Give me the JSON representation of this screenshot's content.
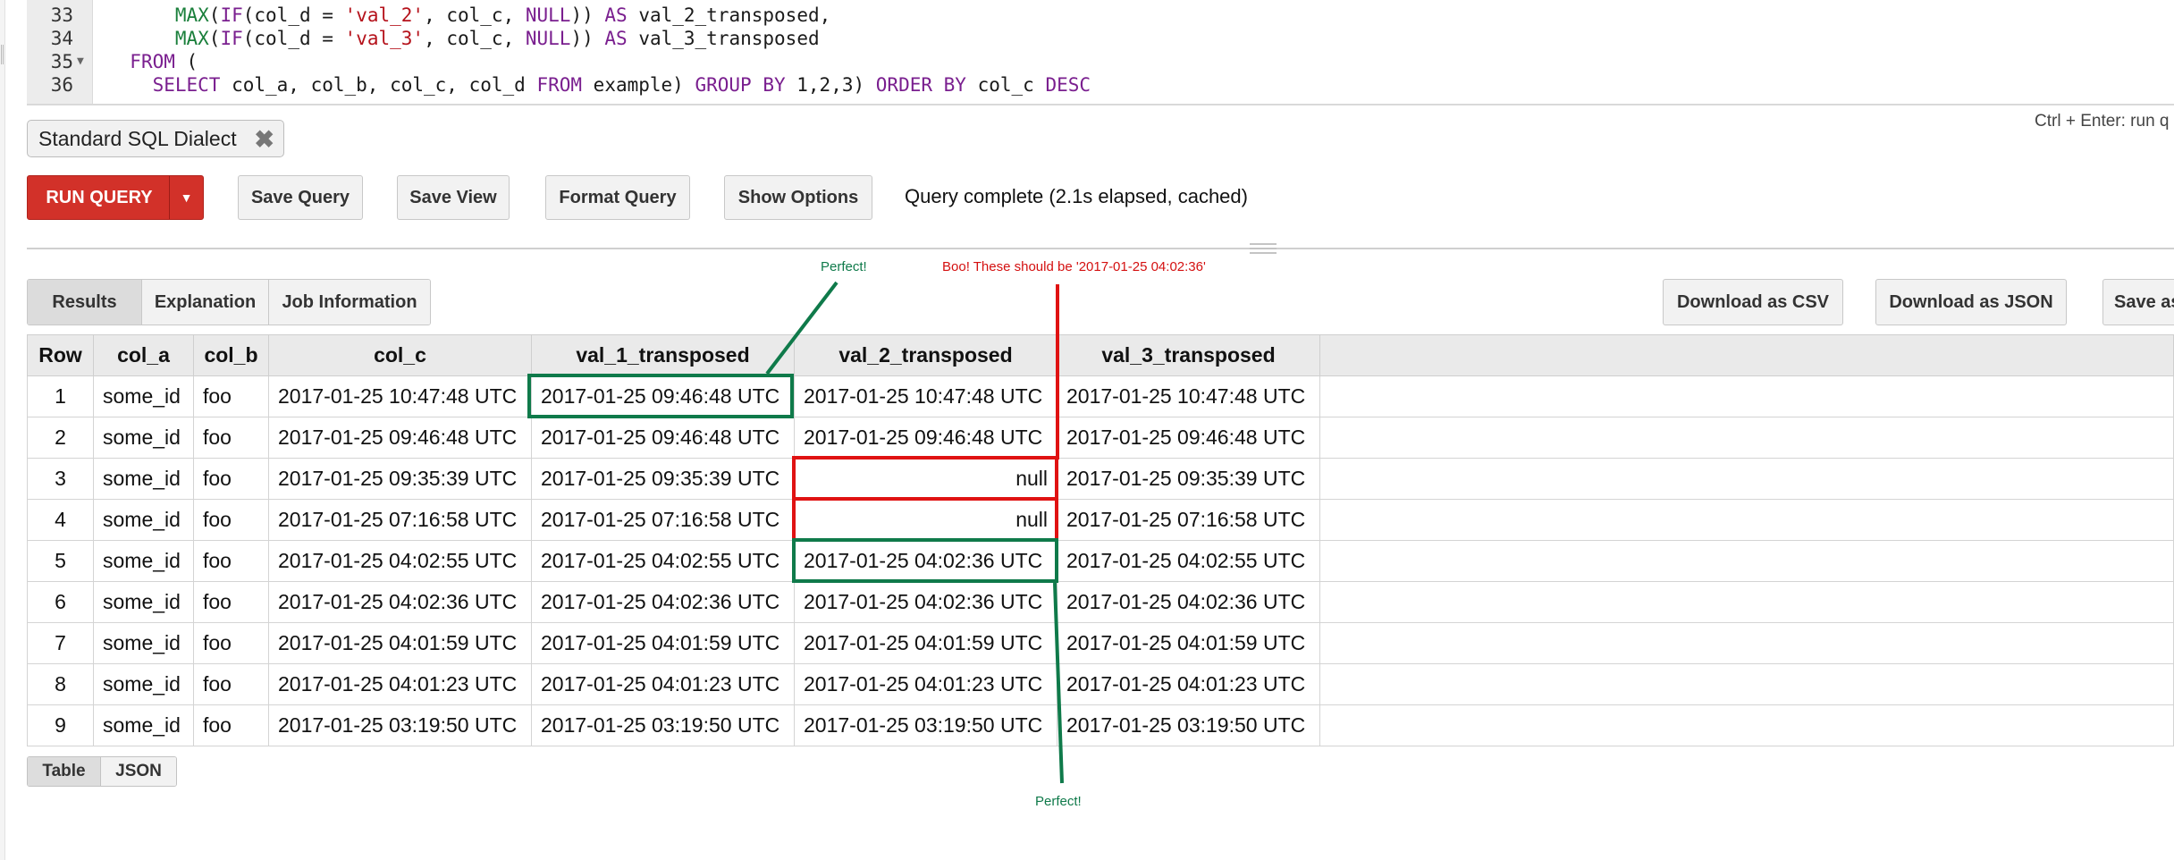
{
  "editor": {
    "lines": [
      {
        "num": "33",
        "fold": "",
        "tokens": [
          {
            "t": "      ",
            "c": "plain"
          },
          {
            "t": "MAX",
            "c": "fn"
          },
          {
            "t": "(",
            "c": "plain"
          },
          {
            "t": "IF",
            "c": "kw"
          },
          {
            "t": "(col_d = ",
            "c": "plain"
          },
          {
            "t": "'val_2'",
            "c": "str"
          },
          {
            "t": ", col_c, ",
            "c": "plain"
          },
          {
            "t": "NULL",
            "c": "kw"
          },
          {
            "t": ")) ",
            "c": "plain"
          },
          {
            "t": "AS",
            "c": "kw"
          },
          {
            "t": " val_2_transposed,",
            "c": "plain"
          }
        ]
      },
      {
        "num": "34",
        "fold": "",
        "tokens": [
          {
            "t": "      ",
            "c": "plain"
          },
          {
            "t": "MAX",
            "c": "fn"
          },
          {
            "t": "(",
            "c": "plain"
          },
          {
            "t": "IF",
            "c": "kw"
          },
          {
            "t": "(col_d = ",
            "c": "plain"
          },
          {
            "t": "'val_3'",
            "c": "str"
          },
          {
            "t": ", col_c, ",
            "c": "plain"
          },
          {
            "t": "NULL",
            "c": "kw"
          },
          {
            "t": ")) ",
            "c": "plain"
          },
          {
            "t": "AS",
            "c": "kw"
          },
          {
            "t": " val_3_transposed",
            "c": "plain"
          }
        ]
      },
      {
        "num": "35",
        "fold": "▼",
        "tokens": [
          {
            "t": "  ",
            "c": "plain"
          },
          {
            "t": "FROM",
            "c": "kw"
          },
          {
            "t": " (",
            "c": "plain"
          }
        ]
      },
      {
        "num": "36",
        "fold": "",
        "tokens": [
          {
            "t": "    ",
            "c": "plain"
          },
          {
            "t": "SELECT",
            "c": "kw"
          },
          {
            "t": " col_a, col_b, col_c, col_d ",
            "c": "plain"
          },
          {
            "t": "FROM",
            "c": "kw"
          },
          {
            "t": " example) ",
            "c": "plain"
          },
          {
            "t": "GROUP BY",
            "c": "kw"
          },
          {
            "t": " 1,2,3) ",
            "c": "plain"
          },
          {
            "t": "ORDER BY",
            "c": "kw"
          },
          {
            "t": " col_c ",
            "c": "plain"
          },
          {
            "t": "DESC",
            "c": "kw"
          }
        ]
      }
    ]
  },
  "dialect": {
    "label": "Standard SQL Dialect",
    "close_glyph": "✖"
  },
  "shortcut_hint": "Ctrl + Enter: run q",
  "toolbar": {
    "run_label": "RUN QUERY",
    "run_caret": "▼",
    "save_query": "Save Query",
    "save_view": "Save View",
    "format_query": "Format Query",
    "show_options": "Show Options",
    "status": "Query complete (2.1s elapsed, cached)"
  },
  "tabs": {
    "results": "Results",
    "explanation": "Explanation",
    "job_information": "Job Information"
  },
  "downloads": {
    "csv": "Download as CSV",
    "json": "Download as JSON",
    "save_as": "Save as"
  },
  "table": {
    "columns": [
      "Row",
      "col_a",
      "col_b",
      "col_c",
      "val_1_transposed",
      "val_2_transposed",
      "val_3_transposed"
    ],
    "rows": [
      [
        "1",
        "some_id",
        "foo",
        "2017-01-25 10:47:48 UTC",
        "2017-01-25 09:46:48 UTC",
        "2017-01-25 10:47:48 UTC",
        "2017-01-25 10:47:48 UTC"
      ],
      [
        "2",
        "some_id",
        "foo",
        "2017-01-25 09:46:48 UTC",
        "2017-01-25 09:46:48 UTC",
        "2017-01-25 09:46:48 UTC",
        "2017-01-25 09:46:48 UTC"
      ],
      [
        "3",
        "some_id",
        "foo",
        "2017-01-25 09:35:39 UTC",
        "2017-01-25 09:35:39 UTC",
        "null",
        "2017-01-25 09:35:39 UTC"
      ],
      [
        "4",
        "some_id",
        "foo",
        "2017-01-25 07:16:58 UTC",
        "2017-01-25 07:16:58 UTC",
        "null",
        "2017-01-25 07:16:58 UTC"
      ],
      [
        "5",
        "some_id",
        "foo",
        "2017-01-25 04:02:55 UTC",
        "2017-01-25 04:02:55 UTC",
        "2017-01-25 04:02:36 UTC",
        "2017-01-25 04:02:55 UTC"
      ],
      [
        "6",
        "some_id",
        "foo",
        "2017-01-25 04:02:36 UTC",
        "2017-01-25 04:02:36 UTC",
        "2017-01-25 04:02:36 UTC",
        "2017-01-25 04:02:36 UTC"
      ],
      [
        "7",
        "some_id",
        "foo",
        "2017-01-25 04:01:59 UTC",
        "2017-01-25 04:01:59 UTC",
        "2017-01-25 04:01:59 UTC",
        "2017-01-25 04:01:59 UTC"
      ],
      [
        "8",
        "some_id",
        "foo",
        "2017-01-25 04:01:23 UTC",
        "2017-01-25 04:01:23 UTC",
        "2017-01-25 04:01:23 UTC",
        "2017-01-25 04:01:23 UTC"
      ],
      [
        "9",
        "some_id",
        "foo",
        "2017-01-25 03:19:50 UTC",
        "2017-01-25 03:19:50 UTC",
        "2017-01-25 03:19:50 UTC",
        "2017-01-25 03:19:50 UTC"
      ]
    ]
  },
  "view_tabs": {
    "table": "Table",
    "json": "JSON"
  },
  "annotations": {
    "perfect_top": "Perfect!",
    "boo": "Boo! These should be '2017-01-25 04:02:36'",
    "perfect_bottom": "Perfect!"
  },
  "colors": {
    "run_button": "#d23129",
    "annotation_green": "#0f7a4a",
    "annotation_red": "#e01212",
    "keyword": "#7a1f8f",
    "function": "#1a7f3b",
    "string": "#b5121b"
  }
}
